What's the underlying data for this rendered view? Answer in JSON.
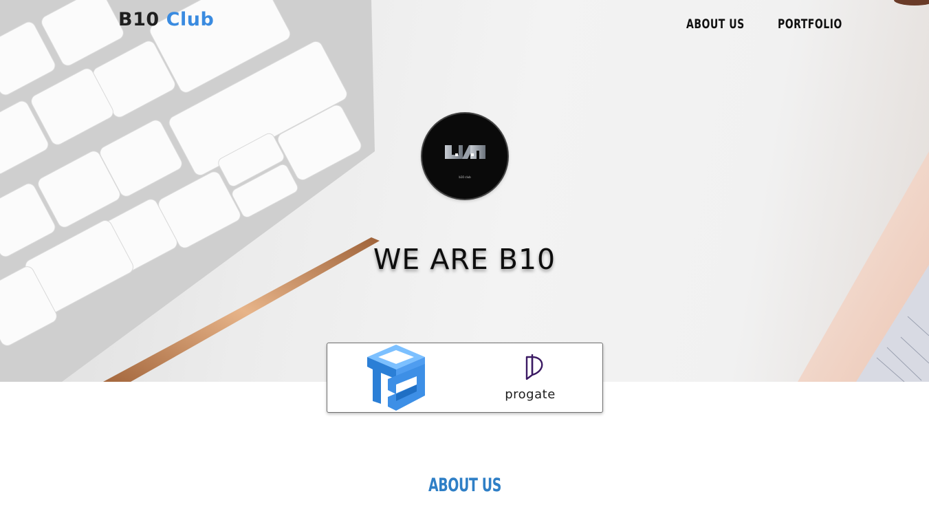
{
  "brand": {
    "part1": "B10",
    "part2": "Club",
    "accent_color": "#3a8be0"
  },
  "nav": {
    "items": [
      {
        "label": "ABOUT US"
      },
      {
        "label": "PORTFOLIO"
      }
    ]
  },
  "hero": {
    "avatar_icon": "b10-emblem-icon",
    "avatar_caption": "b10 club",
    "headline": "WE ARE B10"
  },
  "partners": {
    "items": [
      {
        "name": "ts-cube-logo-icon",
        "label": ""
      },
      {
        "name": "progate-logo-icon",
        "label": "progate"
      }
    ],
    "ts_color": "#3d8fe6",
    "progate_color": "#3b1a63"
  },
  "about": {
    "title": "ABOUT US",
    "title_color": "#2f7fc6"
  }
}
